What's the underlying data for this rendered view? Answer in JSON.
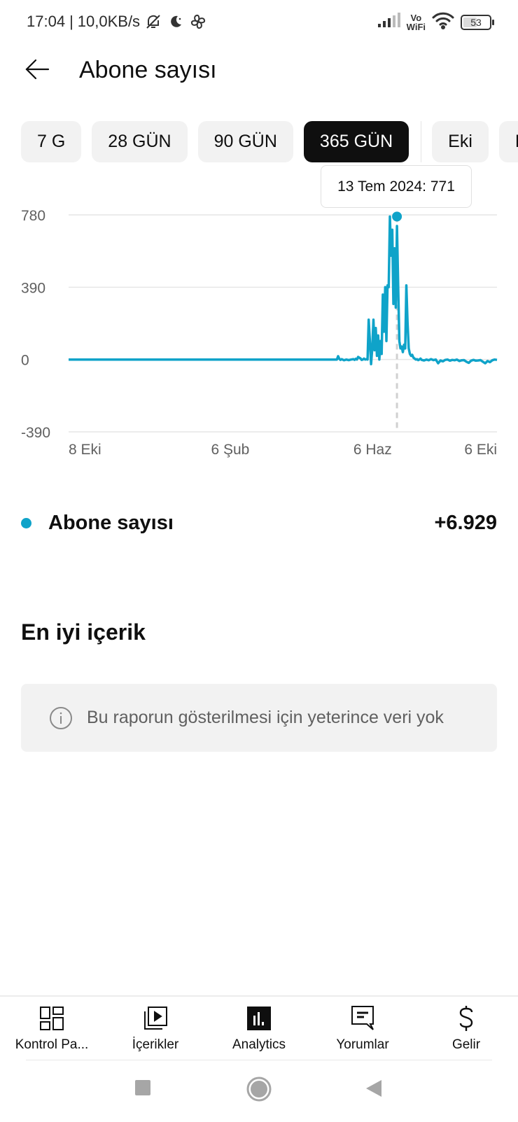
{
  "status_bar": {
    "time": "17:04",
    "separator": "|",
    "net_speed": "10,0KB/s",
    "icons": [
      "bell-off-icon",
      "moon-icon",
      "pinwheel-icon"
    ],
    "vowifi_top": "Vo",
    "vowifi_bottom": "WiFi",
    "battery_level": "53"
  },
  "header": {
    "back_icon": "arrow-left-icon",
    "title": "Abone sayısı"
  },
  "period_chips": [
    {
      "label": "7 G",
      "active": false
    },
    {
      "label": "28 GÜN",
      "active": false
    },
    {
      "label": "90 GÜN",
      "active": false
    },
    {
      "label": "365 GÜN",
      "active": true
    },
    {
      "label": "Eki",
      "active": false
    },
    {
      "label": "Eyl",
      "active": false
    }
  ],
  "tooltip": {
    "text": "13 Tem 2024: 771"
  },
  "colors": {
    "accent": "#0fa3c9",
    "grid": "#e6e6e6",
    "chip_bg": "#f2f2f2",
    "chip_active_bg": "#0f0f0f",
    "card_bg": "#f2f2f2",
    "muted_text": "#606060"
  },
  "chart_data": {
    "type": "line",
    "title": "Abone sayısı",
    "xlabel": "",
    "ylabel": "",
    "ylim": [
      -390,
      780
    ],
    "yticks": [
      "780",
      "390",
      "0",
      "-390"
    ],
    "ytick_values": [
      780,
      390,
      0,
      -390
    ],
    "xticks": [
      "8 Eki",
      "6 Şub",
      "6 Haz",
      "6 Eki"
    ],
    "xtick_days": [
      0,
      121,
      242,
      364
    ],
    "grid": true,
    "legend": "below",
    "highlight": {
      "label": "13 Tem 2024",
      "day": 279,
      "value": 771
    },
    "series": [
      {
        "name": "Abone sayısı",
        "total": "+6.929",
        "days": [
          0,
          228,
          229,
          230,
          231,
          232,
          234,
          236,
          238,
          240,
          242,
          243,
          244,
          245,
          246,
          248,
          249,
          250,
          251,
          252,
          253,
          254,
          255,
          256,
          257,
          258,
          259,
          260,
          261,
          262,
          263,
          264,
          265,
          266,
          267,
          268,
          269,
          270,
          271,
          272,
          273,
          274,
          275,
          276,
          277,
          278,
          279,
          280,
          281,
          282,
          283,
          284,
          285,
          286,
          287,
          288,
          289,
          290,
          291,
          292,
          293,
          294,
          295,
          296,
          297,
          298,
          299,
          300,
          302,
          304,
          306,
          308,
          310,
          312,
          314,
          316,
          318,
          320,
          322,
          324,
          326,
          328,
          330,
          332,
          334,
          336,
          338,
          340,
          342,
          344,
          346,
          348,
          350,
          352,
          354,
          356,
          358,
          360,
          362,
          364
        ],
        "values": [
          0,
          0,
          18,
          4,
          -2,
          2,
          -4,
          0,
          -3,
          0,
          2,
          -2,
          4,
          0,
          14,
          6,
          -2,
          0,
          5,
          0,
          2,
          0,
          215,
          100,
          -25,
          60,
          215,
          50,
          170,
          20,
          130,
          0,
          100,
          30,
          350,
          150,
          390,
          100,
          400,
          390,
          771,
          560,
          700,
          300,
          600,
          280,
          720,
          400,
          100,
          60,
          70,
          40,
          80,
          60,
          400,
          200,
          60,
          30,
          20,
          25,
          10,
          5,
          0,
          2,
          -3,
          0,
          5,
          -2,
          -5,
          0,
          -4,
          2,
          -3,
          0,
          -20,
          -5,
          -10,
          -2,
          0,
          -6,
          -2,
          -4,
          0,
          -8,
          -4,
          -3,
          -12,
          -18,
          -6,
          -2,
          -6,
          -5,
          -3,
          -12,
          -20,
          -8,
          -14,
          -4,
          0,
          -2
        ]
      }
    ]
  },
  "legend": {
    "label": "Abone sayısı",
    "value": "+6.929"
  },
  "top_content": {
    "title": "En iyi içerik",
    "empty_message": "Bu raporun gösterilmesi için yeterince veri yok",
    "icon": "info-icon"
  },
  "bottom_nav": [
    {
      "label": "Kontrol Pa...",
      "icon": "dashboard-icon",
      "active": false
    },
    {
      "label": "İçerikler",
      "icon": "content-library-icon",
      "active": false
    },
    {
      "label": "Analytics",
      "icon": "analytics-icon",
      "active": true
    },
    {
      "label": "Yorumlar",
      "icon": "comments-icon",
      "active": false
    },
    {
      "label": "Gelir",
      "icon": "dollar-icon",
      "active": false
    }
  ],
  "system_nav": {
    "buttons": [
      "recents-button",
      "home-button",
      "back-button"
    ]
  }
}
